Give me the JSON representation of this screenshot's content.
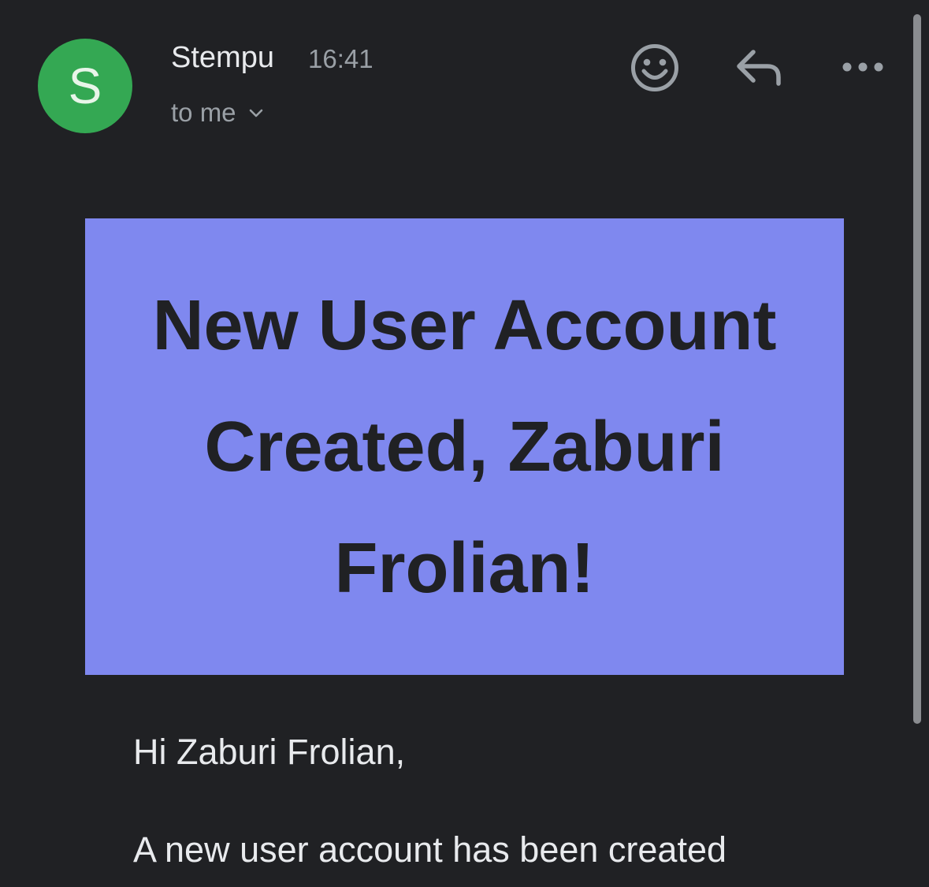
{
  "header": {
    "avatar_letter": "S",
    "sender_name": "Stempu",
    "time": "16:41",
    "recipient_label": "to me",
    "avatar_color": "#34a853"
  },
  "actions": {
    "emoji_icon": "smiley-icon",
    "reply_icon": "reply-icon",
    "more_icon": "more-horizontal-icon"
  },
  "banner": {
    "title": "New User Account Created, Zaburi Frolian!",
    "background": "#7f88ef"
  },
  "body": {
    "greeting": "Hi Zaburi Frolian,",
    "paragraph": "A new user account has been created"
  }
}
